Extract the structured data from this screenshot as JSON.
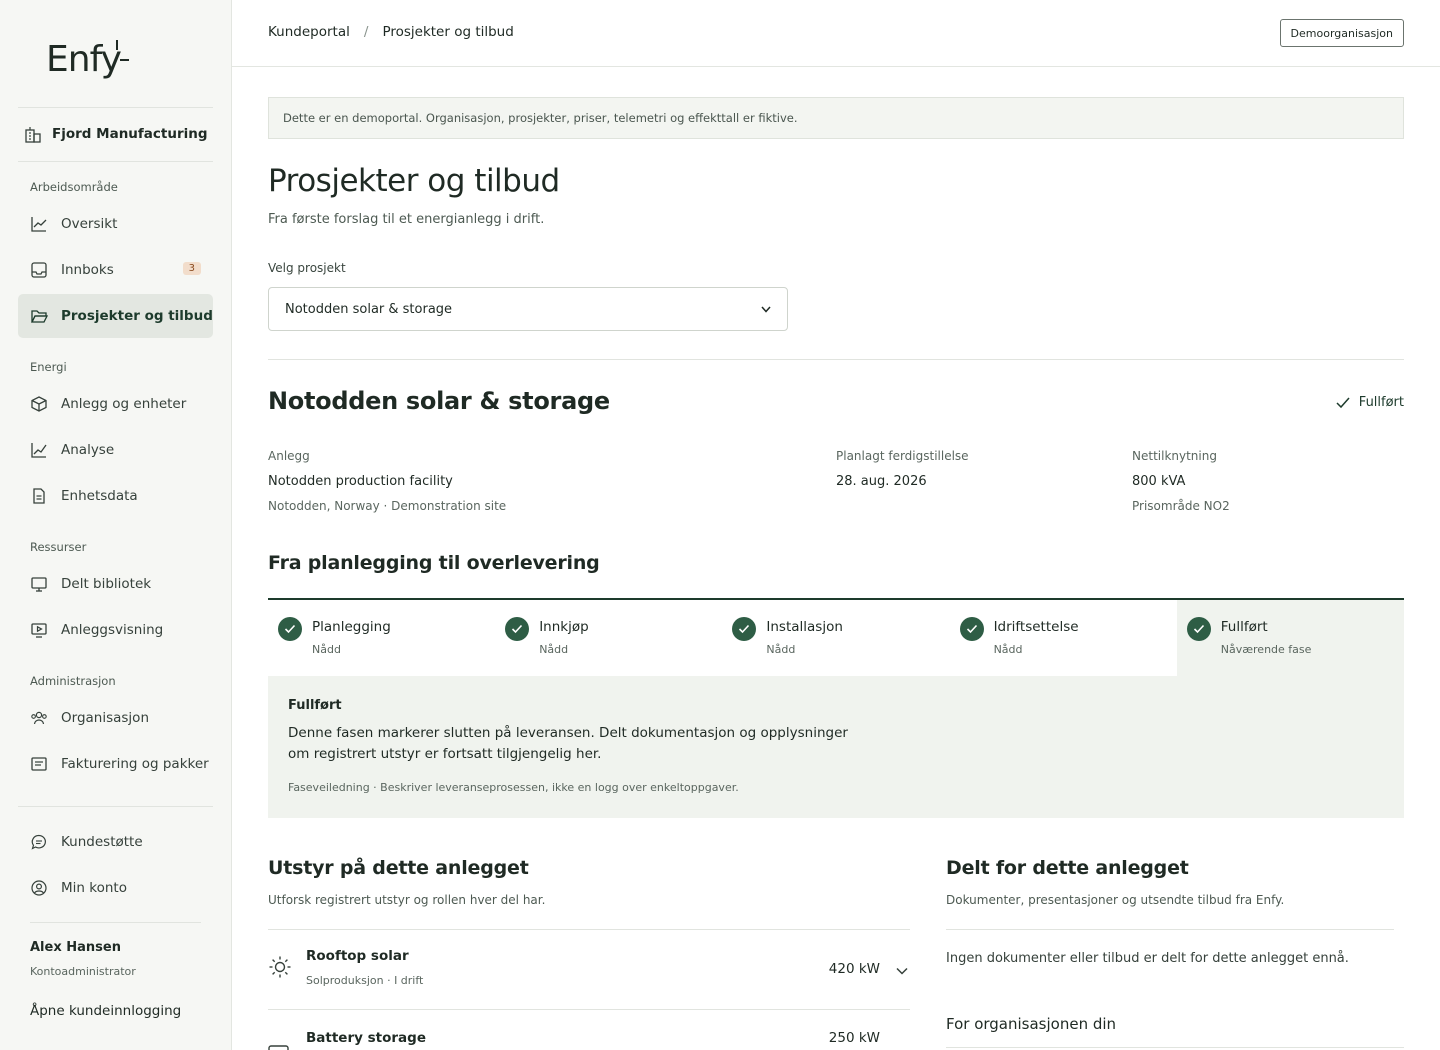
{
  "brand": {
    "logo_text": "Enfy"
  },
  "org": {
    "name": "Fjord Manufacturing"
  },
  "sidebar": {
    "sections": [
      "Arbeidsområde",
      "Energi",
      "Ressurser",
      "Administrasjon"
    ],
    "items": [
      {
        "label": "Oversikt"
      },
      {
        "label": "Innboks",
        "badge": "3"
      },
      {
        "label": "Prosjekter og tilbud"
      },
      {
        "label": "Anlegg og enheter"
      },
      {
        "label": "Analyse"
      },
      {
        "label": "Enhetsdata"
      },
      {
        "label": "Delt bibliotek"
      },
      {
        "label": "Anleggsvisning"
      },
      {
        "label": "Organisasjon"
      },
      {
        "label": "Fakturering og pakker"
      },
      {
        "label": "Kundestøtte"
      },
      {
        "label": "Min konto"
      }
    ],
    "user": {
      "name": "Alex Hansen",
      "role": "Kontoadministrator"
    },
    "open_login": "Åpne kundeinnlogging"
  },
  "topbar": {
    "breadcrumb": [
      "Kundeportal",
      "Prosjekter og tilbud"
    ],
    "separator": "/",
    "demo_button": "Demoorganisasjon"
  },
  "notice": "Dette er en demoportal. Organisasjon, prosjekter, priser, telemetri og effekttall er fiktive.",
  "page": {
    "title": "Prosjekter og tilbud",
    "subtitle": "Fra første forslag til et energianlegg i drift.",
    "select_label": "Velg prosjekt",
    "selected_project": "Notodden solar & storage"
  },
  "project": {
    "title": "Notodden solar & storage",
    "status": "Fullført",
    "info": [
      {
        "label": "Anlegg",
        "value": "Notodden production facility",
        "sub": "Notodden, Norway · Demonstration site"
      },
      {
        "label": "Planlagt ferdigstillelse",
        "value": "28. aug. 2026",
        "sub": ""
      },
      {
        "label": "Nettilknytning",
        "value": "800 kVA",
        "sub": "Prisområde NO2"
      }
    ]
  },
  "phases": {
    "heading": "Fra planlegging til overlevering",
    "steps": [
      {
        "label": "Planlegging",
        "state": "Nådd"
      },
      {
        "label": "Innkjøp",
        "state": "Nådd"
      },
      {
        "label": "Installasjon",
        "state": "Nådd"
      },
      {
        "label": "Idriftsettelse",
        "state": "Nådd"
      },
      {
        "label": "Fullført",
        "state": "Nåværende fase"
      }
    ],
    "panel": {
      "title": "Fullført",
      "text": "Denne fasen markerer slutten på leveransen. Delt dokumentasjon og opplysninger om registrert utstyr er fortsatt tilgjengelig her.",
      "note": "Faseveiledning · Beskriver leveranseprosessen, ikke en logg over enkeltoppgaver."
    }
  },
  "equipment": {
    "heading": "Utstyr på dette anlegget",
    "subtitle": "Utforsk registrert utstyr og rollen hver del har.",
    "items": [
      {
        "name": "Rooftop solar",
        "meta": "Solproduksjon · I drift",
        "power": "420 kW",
        "icon": "sun-icon"
      },
      {
        "name": "Battery storage",
        "meta": "",
        "power": "250 kW",
        "icon": "battery-icon"
      }
    ]
  },
  "shared": {
    "heading": "Delt for dette anlegget",
    "subtitle": "Dokumenter, presentasjoner og utsendte tilbud fra Enfy.",
    "empty": "Ingen dokumenter eller tilbud er delt for dette anlegget ennå.",
    "org_heading": "For organisasjonen din"
  },
  "colors": {
    "accent": "#1d3b2c",
    "check_fill": "#2e5d45",
    "active_nav_bg": "#e3e7e1",
    "panel_bg": "#f0f3ee",
    "badge_bg": "#f2ddcb"
  }
}
